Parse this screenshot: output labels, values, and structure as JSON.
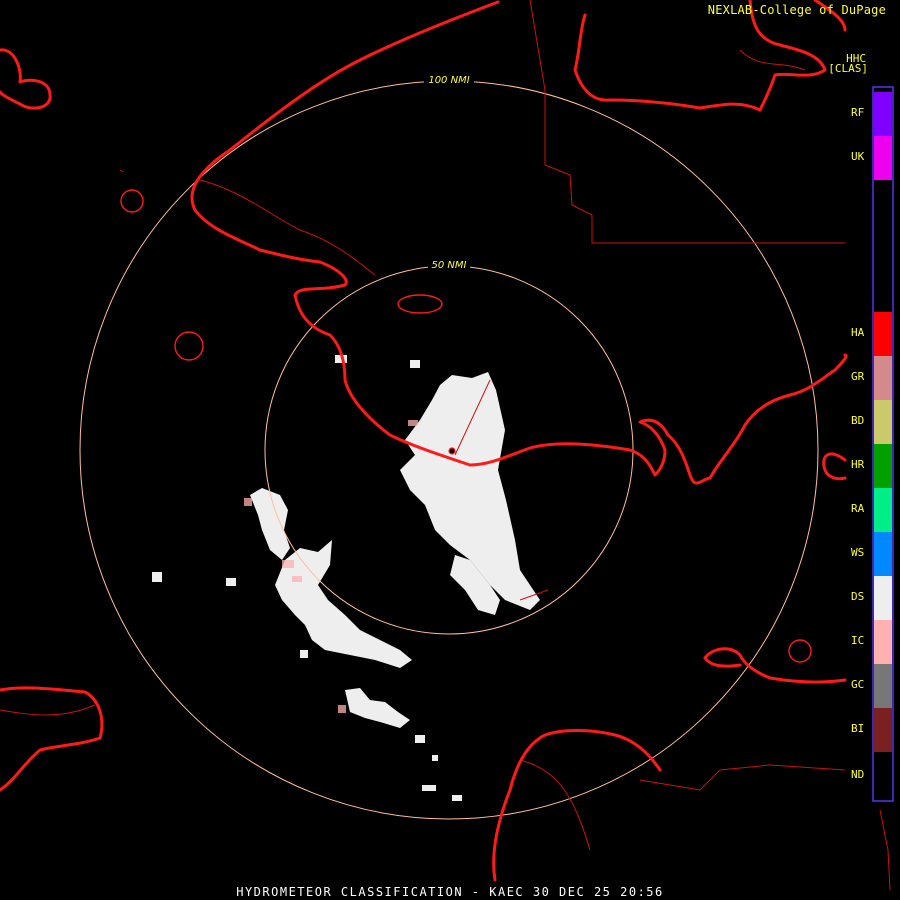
{
  "credit": "NEXLAB-College of DuPage",
  "product_code": "HHC",
  "unit": "[CLAS]",
  "footer_title": "HYDROMETEOR CLASSIFICATION - KAEC 30 DEC 25 20:56",
  "range_rings": [
    "100 NMI",
    "50 NMI"
  ],
  "legend": [
    {
      "code": "RF",
      "color": "#7f00ff"
    },
    {
      "code": "UK",
      "color": "#ee00ee"
    },
    {
      "code": "HA",
      "color": "#ff0000"
    },
    {
      "code": "GR",
      "color": "#d48a8a"
    },
    {
      "code": "BD",
      "color": "#caca6a"
    },
    {
      "code": "HR",
      "color": "#00a000"
    },
    {
      "code": "RA",
      "color": "#00ee88"
    },
    {
      "code": "WS",
      "color": "#0088ff"
    },
    {
      "code": "DS",
      "color": "#eeeeee"
    },
    {
      "code": "IC",
      "color": "#ffb0b0"
    },
    {
      "code": "GC",
      "color": "#777777"
    },
    {
      "code": "BI",
      "color": "#7a2020"
    },
    {
      "code": "ND",
      "color": "#000000"
    }
  ],
  "colors": {
    "coast": "#ff1a1a",
    "ring": "#ffbfa0",
    "label": "#ffff33",
    "legend_border": "#5533ee"
  }
}
